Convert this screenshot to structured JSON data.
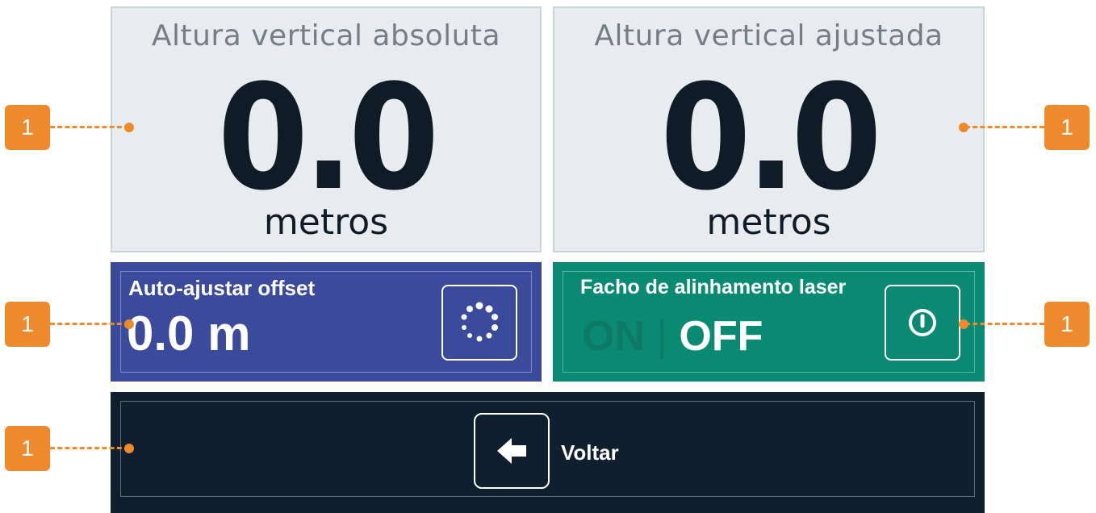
{
  "panels": {
    "absolute": {
      "title": "Altura vertical absoluta",
      "value": "0.0",
      "unit": "metros"
    },
    "adjusted": {
      "title": "Altura vertical ajustada",
      "value": "0.0",
      "unit": "metros"
    }
  },
  "offset_control": {
    "label": "Auto-ajustar offset",
    "value": "0.0 m",
    "button_icon": "spinner-icon"
  },
  "laser_control": {
    "label": "Facho de alinhamento laser",
    "state_on": "ON",
    "separator": "|",
    "state_off": "OFF",
    "button_icon": "power-icon"
  },
  "back_control": {
    "label": "Voltar",
    "button_icon": "arrow-left-icon"
  },
  "callouts": {
    "c1": "1",
    "c2": "1",
    "c3": "1",
    "c4": "1",
    "c5": "1"
  },
  "colors": {
    "panel_light_bg": "#e8ecee",
    "offset_bg": "#3b4a9b",
    "laser_bg": "#0a8a72",
    "back_bg": "#0f1f2e",
    "callout": "#ee8a2e"
  }
}
